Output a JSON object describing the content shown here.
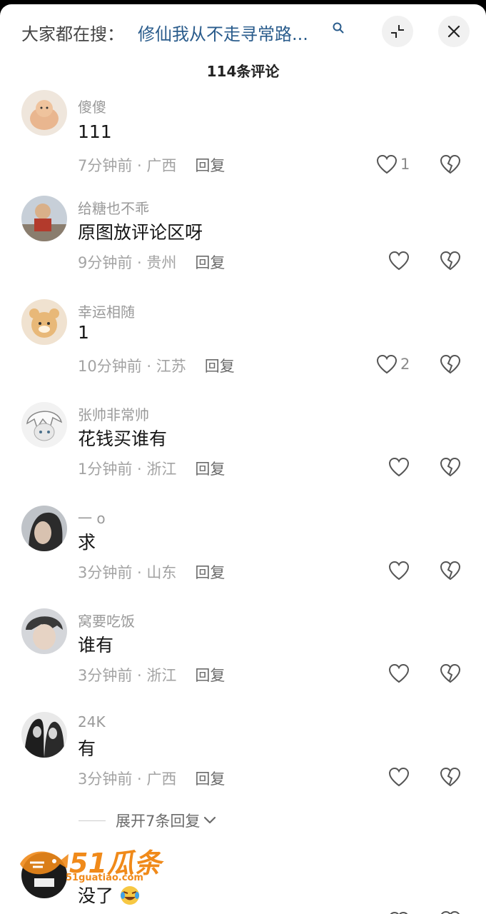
{
  "header": {
    "search_prefix": "大家都在搜：",
    "search_term": "修仙我从不走寻常路...",
    "title": "114条评论"
  },
  "icons": {
    "search": "search-icon",
    "collapse": "collapse-icon",
    "close": "close-icon",
    "like": "heart-icon",
    "dislike": "broken-heart-icon",
    "expand": "chevron-down-icon"
  },
  "comments": [
    {
      "username": "傻傻",
      "content": "111",
      "time": "7分钟前",
      "location": "广西",
      "reply": "回复",
      "likes": "1"
    },
    {
      "username": "给糖也不乖",
      "content": "原图放评论区呀",
      "time": "9分钟前",
      "location": "贵州",
      "reply": "回复",
      "likes": ""
    },
    {
      "username": "幸运相随",
      "content": "1",
      "time": "10分钟前",
      "location": "江苏",
      "reply": "回复",
      "likes": "2"
    },
    {
      "username": "张帅非常帅",
      "content": "花钱买谁有",
      "time": "1分钟前",
      "location": "浙江",
      "reply": "回复",
      "likes": ""
    },
    {
      "username": "一 o",
      "content": "求",
      "time": "3分钟前",
      "location": "山东",
      "reply": "回复",
      "likes": ""
    },
    {
      "username": "窝要吃饭",
      "content": "谁有",
      "time": "3分钟前",
      "location": "浙江",
      "reply": "回复",
      "likes": ""
    },
    {
      "username": "24K",
      "content": "有",
      "time": "3分钟前",
      "location": "广西",
      "reply": "回复",
      "likes": ""
    }
  ],
  "expand_replies": "展开7条回复",
  "partial_comment": {
    "content": "没了"
  },
  "watermark": {
    "text": "51瓜条",
    "sub": "51guatiao.com"
  },
  "colors": {
    "search_term": "#2a5c8c",
    "watermark": "#f08a1a"
  }
}
